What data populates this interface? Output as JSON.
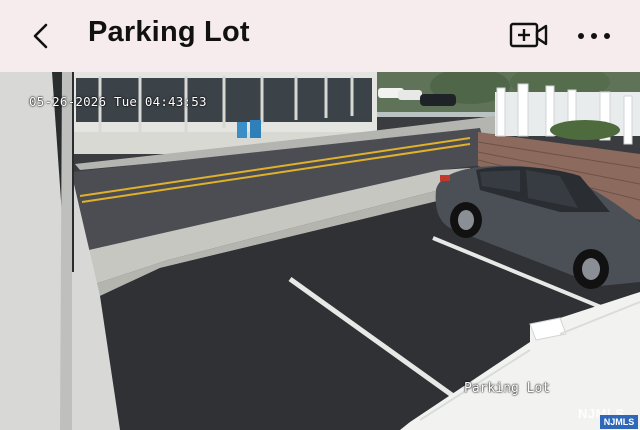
{
  "header": {
    "title": "Parking Lot",
    "back_icon": "chevron-left-icon",
    "camera_icon": "video-camera-add-icon",
    "more_icon": "more-horizontal-icon",
    "background": "#f6ecee"
  },
  "feed": {
    "timestamp": "05-26-2026 Tue 04:43:53",
    "camera_label": "Parking Lot",
    "watermark": "NJMLS",
    "badge": "NJMLS"
  }
}
